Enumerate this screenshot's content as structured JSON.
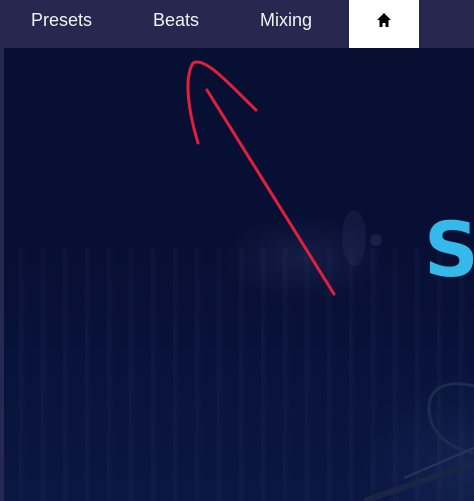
{
  "nav": {
    "items": [
      {
        "label": "Presets"
      },
      {
        "label": "Beats"
      },
      {
        "label": "Mixing"
      }
    ],
    "home_icon": "home-icon"
  },
  "hero": {
    "title": "So"
  },
  "colors": {
    "navbar": "#26284f",
    "nav_text": "#f2f2f7",
    "home_tab": "#ffffff",
    "hero_bg": "#071033",
    "hero_title": "#35b9ea",
    "annotation": "#e0203a"
  }
}
